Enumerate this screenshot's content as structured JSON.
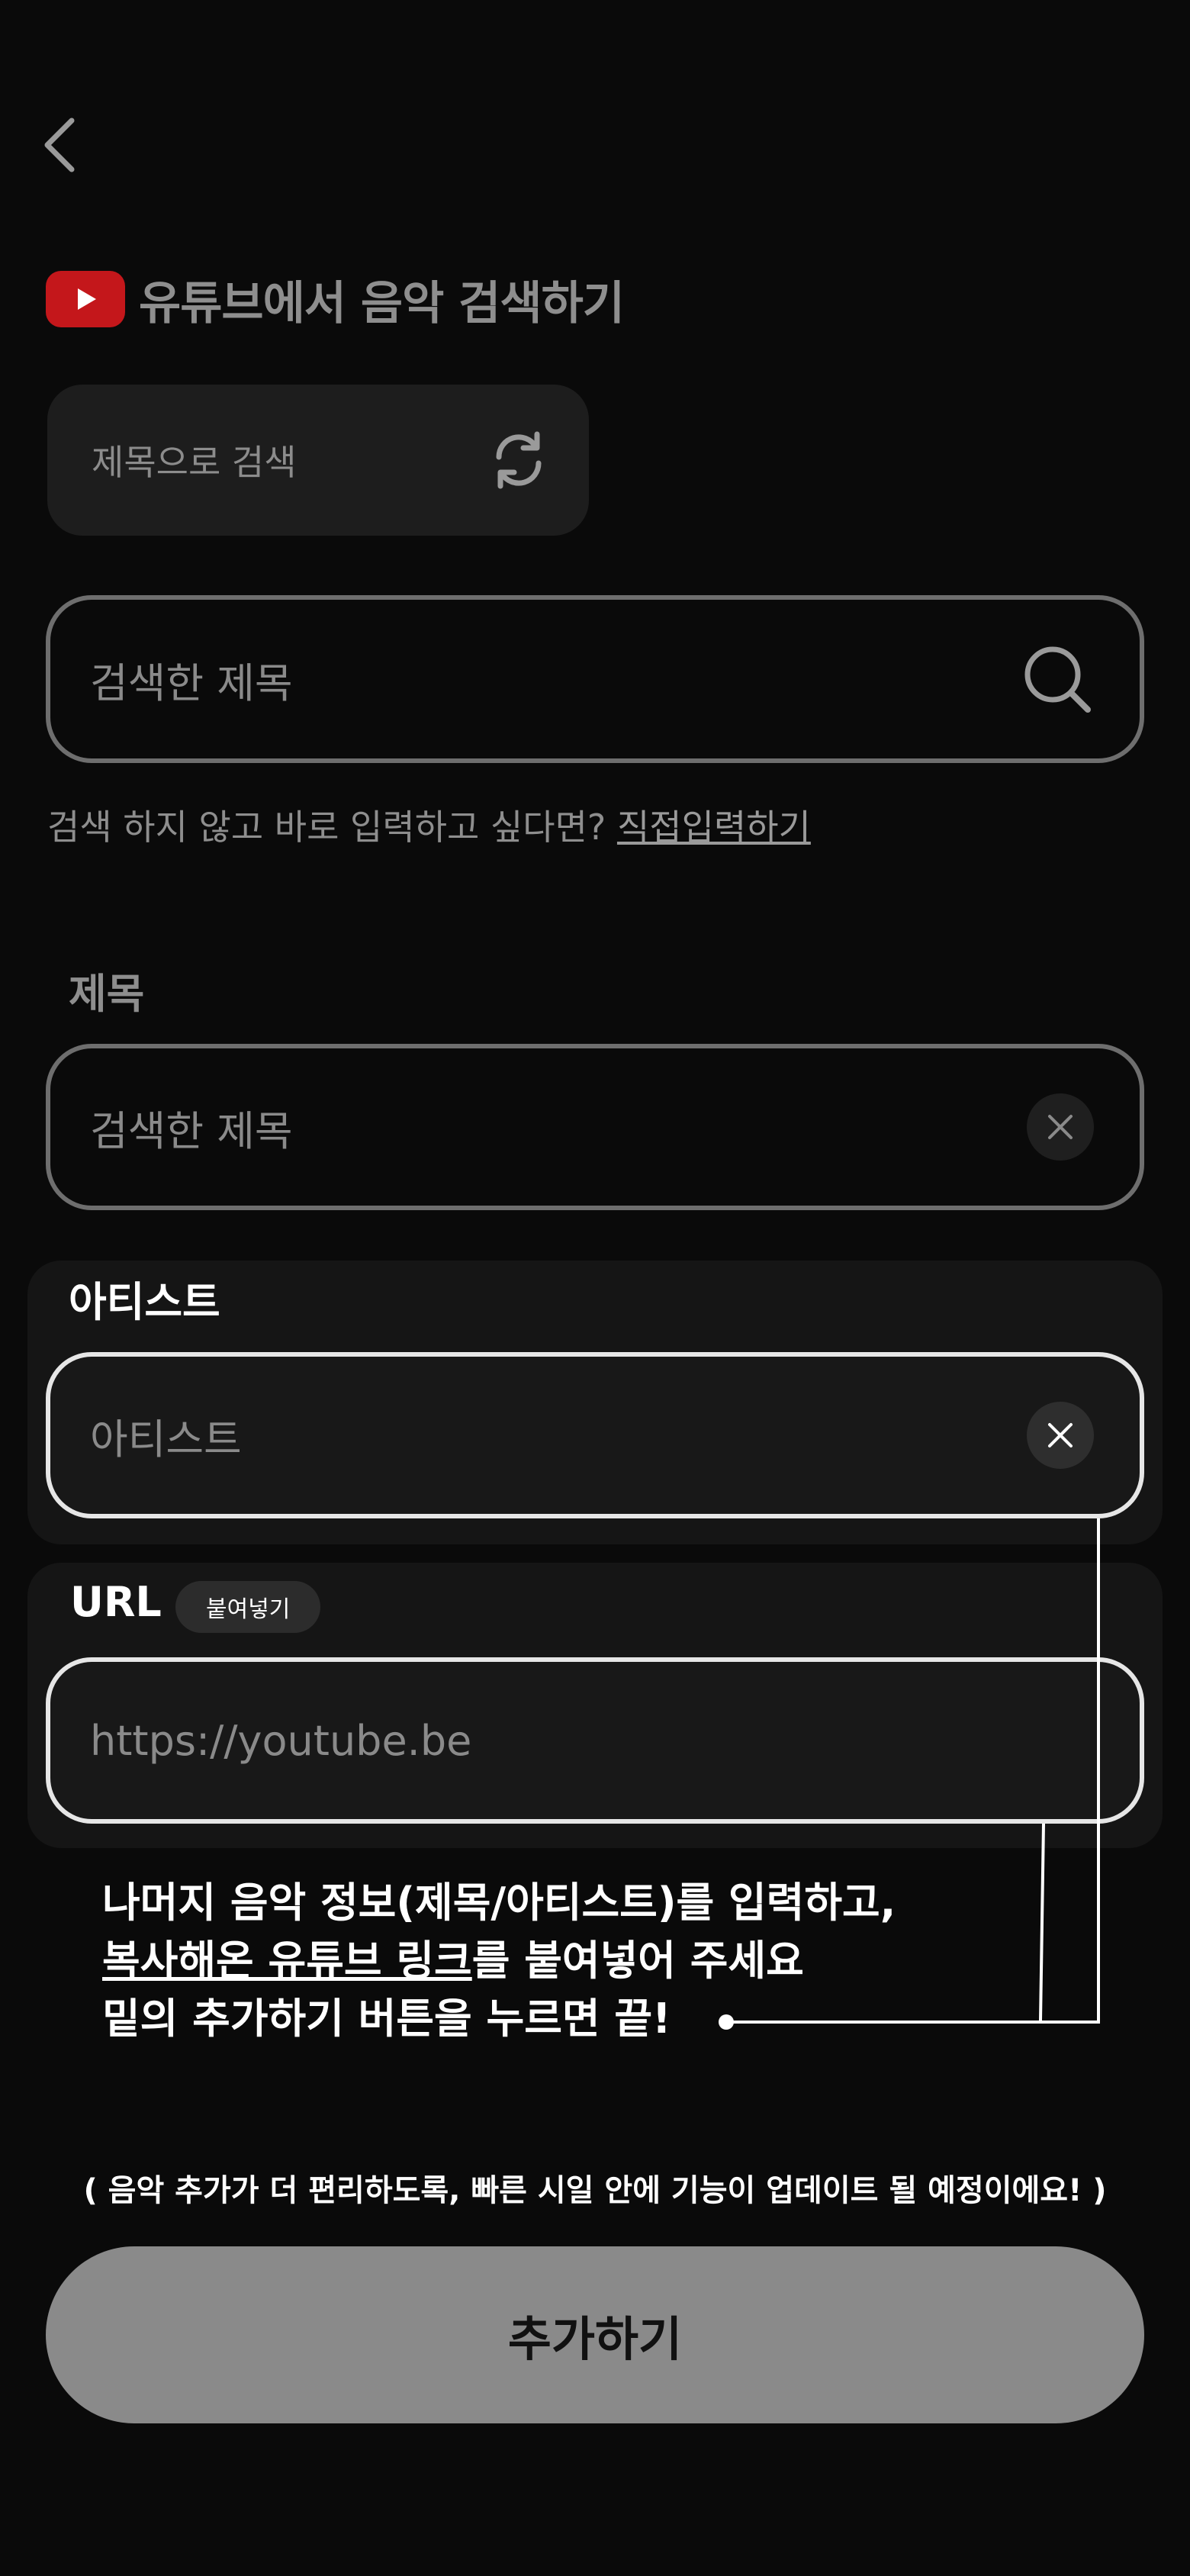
{
  "header": {
    "back_icon": "chevron-left-icon",
    "section_title": "유튜브에서 음악 검색하기",
    "brand_color": "#c4171b"
  },
  "search_mode": {
    "label": "제목으로 검색",
    "icon": "refresh-icon"
  },
  "search": {
    "placeholder": "검색한 제목",
    "icon": "search-icon"
  },
  "hint": {
    "text": "검색 하지 않고 바로 입력하고 싶다면? ",
    "link": "직접입력하기"
  },
  "form": {
    "title": {
      "label": "제목",
      "placeholder": "검색한 제목"
    },
    "artist": {
      "label": "아티스트",
      "placeholder": "아티스트"
    },
    "url": {
      "label": "URL",
      "paste_label": "붙여넣기",
      "placeholder": "https://youtube.be"
    }
  },
  "instructions": {
    "line1": "나머지 음악 정보(제목/아티스트)를 입력하고,",
    "line2_underlined": "복사해온 유튜브 링크",
    "line2_rest": "를 붙여넣어 주세요",
    "line3": "밑의 추가하기 버튼을 누르면 끝!"
  },
  "notice": "( 음악 추가가 더 편리하도록, 빠른 시일 안에 기능이 업데이트 될 예정이에요! )",
  "add_button_label": "추가하기"
}
